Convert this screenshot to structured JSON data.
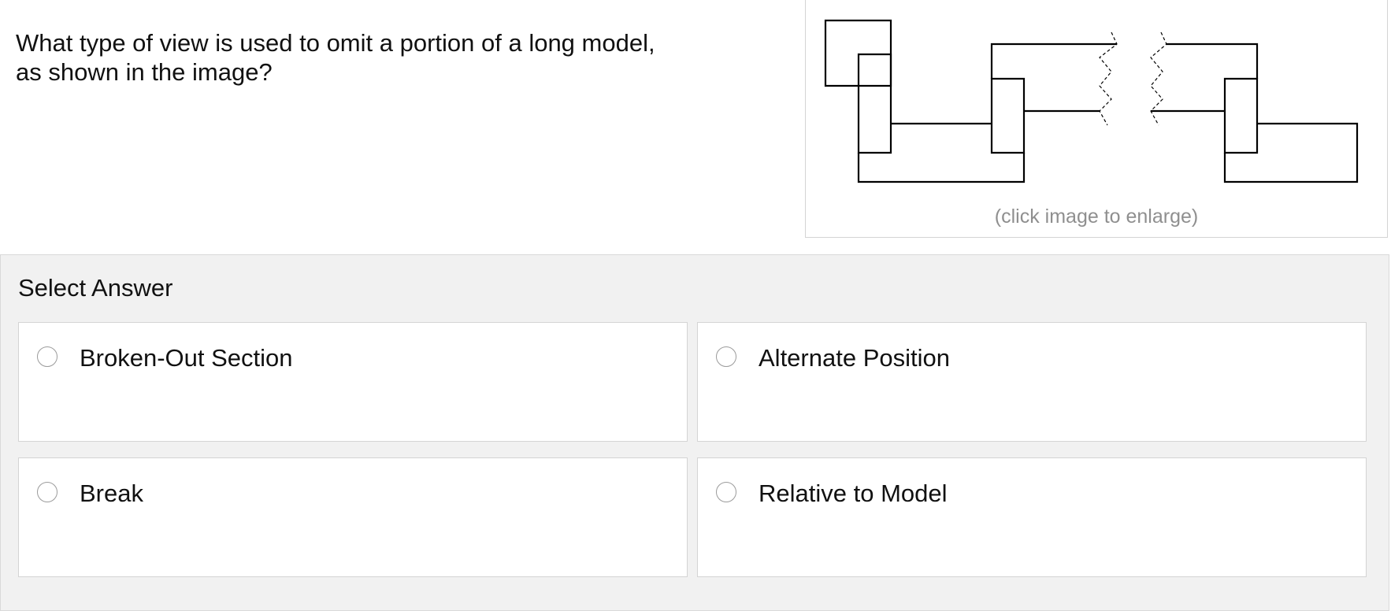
{
  "question": {
    "lines": [
      "What type of view is used to omit a portion of a long model,",
      "as shown in the image?"
    ]
  },
  "figure": {
    "caption": "(click image to enlarge)",
    "icon": "break-view-drawing"
  },
  "answers": {
    "heading": "Select Answer",
    "options": [
      {
        "label": "Broken-Out Section",
        "selected": false
      },
      {
        "label": "Alternate Position",
        "selected": false
      },
      {
        "label": "Break",
        "selected": false
      },
      {
        "label": "Relative to Model",
        "selected": false
      }
    ]
  },
  "colors": {
    "panel_background": "#f1f1f1",
    "border": "#d4d4d4",
    "caption_text": "#8f8f8f"
  }
}
